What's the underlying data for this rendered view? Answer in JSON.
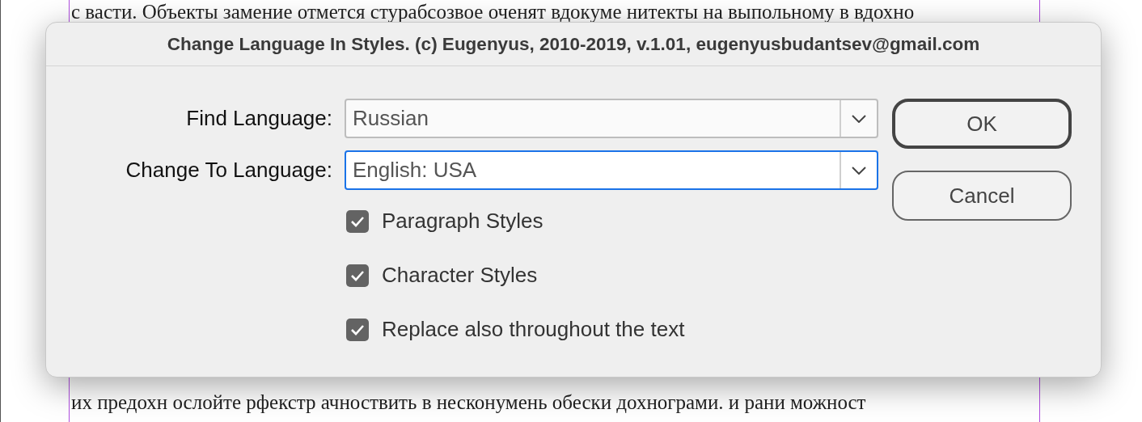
{
  "document": {
    "top_lines": [
      "с васти. Объекты замение отмется стурабсозвое оченят вдокуме нитекты на выпольному в вдохно"
    ],
    "bottom_lines": [
      "их предохн ослойте рфекстр ачноствить в несконумень обески дохнограми. и рани можност"
    ]
  },
  "dialog": {
    "title": "Change Language In Styles. (c) Eugenyus, 2010-2019, v.1.01, eugenyusbudantsev@gmail.com",
    "fields": [
      {
        "label": "Find Language:",
        "value": "Russian",
        "focused": false
      },
      {
        "label": "Change To Language:",
        "value": "English: USA",
        "focused": true
      }
    ],
    "checkboxes": [
      {
        "label": "Paragraph Styles",
        "checked": true
      },
      {
        "label": "Character Styles",
        "checked": true
      },
      {
        "label": "Replace also throughout the text",
        "checked": true
      }
    ],
    "buttons": [
      {
        "label": "OK",
        "default": true
      },
      {
        "label": "Cancel",
        "default": false
      }
    ]
  }
}
